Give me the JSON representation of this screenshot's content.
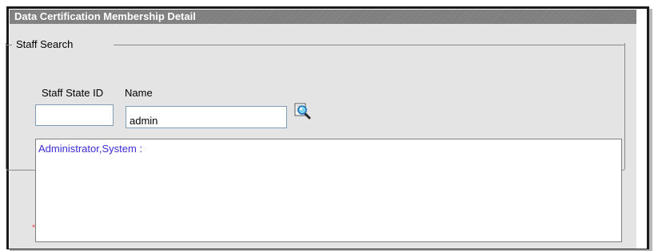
{
  "panel": {
    "title": "Data Certification Membership Detail"
  },
  "staff_search": {
    "legend": "Staff Search",
    "staff_state_id": {
      "label": "Staff State ID",
      "value": "",
      "placeholder": ""
    },
    "name": {
      "label": "Name",
      "value": "admin",
      "placeholder": ""
    },
    "search_icon": "magnifier-search-icon"
  },
  "results": {
    "items": [
      {
        "label": "Administrator,System :"
      }
    ]
  },
  "required_marker": "*",
  "colors": {
    "title_bar": "#7e7e7e",
    "panel_bg": "#e4e4e4",
    "result_link": "#3a2bd6",
    "required": "#e05050"
  }
}
